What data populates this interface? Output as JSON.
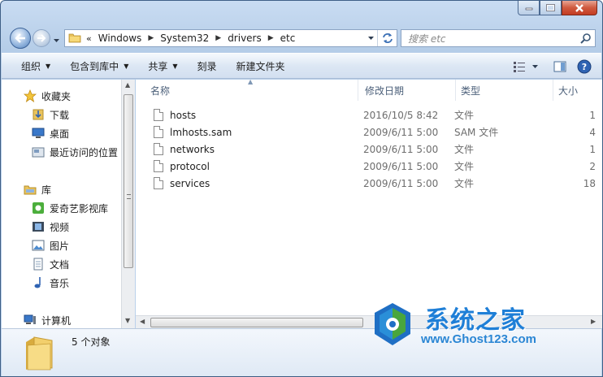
{
  "address": {
    "crumbs": [
      "Windows",
      "System32",
      "drivers",
      "etc"
    ],
    "overflow": "«"
  },
  "search": {
    "placeholder": "搜索 etc"
  },
  "toolbar": {
    "organize": "组织",
    "include_in_library": "包含到库中",
    "share": "共享",
    "burn": "刻录",
    "new_folder": "新建文件夹"
  },
  "navpane": {
    "favorites": "收藏夹",
    "downloads": "下载",
    "desktop": "桌面",
    "recent": "最近访问的位置",
    "libraries": "库",
    "iqiyi": "爱奇艺影视库",
    "videos": "视频",
    "pictures": "图片",
    "documents": "文档",
    "music": "音乐",
    "computer": "计算机"
  },
  "columns": {
    "name": "名称",
    "date": "修改日期",
    "type": "类型",
    "size": "大小"
  },
  "files": [
    {
      "name": "hosts",
      "date": "2016/10/5 8:42",
      "type": "文件",
      "size": "1"
    },
    {
      "name": "lmhosts.sam",
      "date": "2009/6/11 5:00",
      "type": "SAM 文件",
      "size": "4"
    },
    {
      "name": "networks",
      "date": "2009/6/11 5:00",
      "type": "文件",
      "size": "1"
    },
    {
      "name": "protocol",
      "date": "2009/6/11 5:00",
      "type": "文件",
      "size": "2"
    },
    {
      "name": "services",
      "date": "2009/6/11 5:00",
      "type": "文件",
      "size": "18"
    }
  ],
  "details": {
    "count": "5 个对象"
  },
  "watermark": {
    "title": "系统之家",
    "url": "www.Ghost123.com"
  },
  "colors": {
    "accent": "#1f7fd7",
    "frame": "#b5cde8"
  }
}
